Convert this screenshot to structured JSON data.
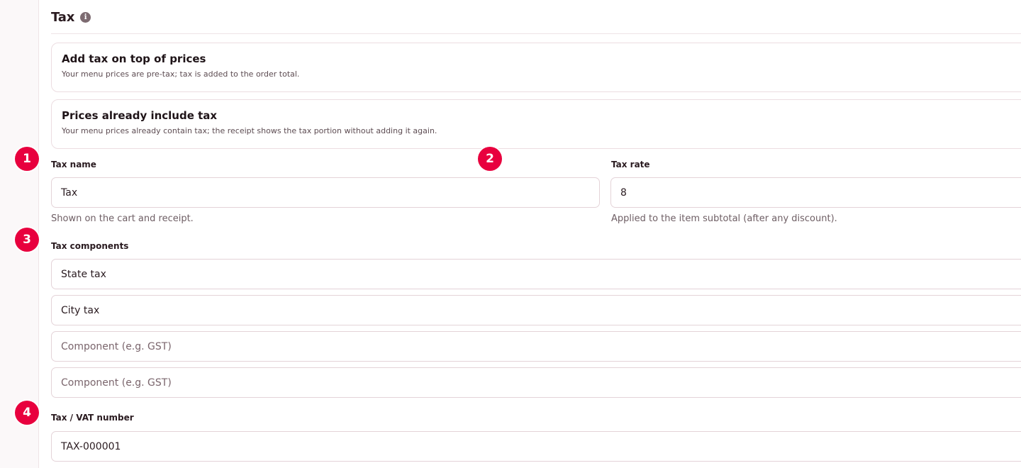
{
  "section": {
    "title": "Tax"
  },
  "options": [
    {
      "title": "Add tax on top of prices",
      "description": "Your menu prices are pre-tax; tax is added to the order total."
    },
    {
      "title": "Prices already include tax",
      "description": "Your menu prices already contain tax; the receipt shows the tax portion without adding it again."
    }
  ],
  "tax_name": {
    "label": "Tax name",
    "value": "Tax",
    "help": "Shown on the cart and receipt."
  },
  "tax_rate": {
    "label": "Tax rate",
    "value": "8",
    "help": "Applied to the item subtotal (after any discount)."
  },
  "components": {
    "label": "Tax components",
    "items": [
      {
        "value": "State tax",
        "placeholder": ""
      },
      {
        "value": "City tax",
        "placeholder": ""
      },
      {
        "value": "",
        "placeholder": "Component (e.g. GST)"
      },
      {
        "value": "",
        "placeholder": "Component (e.g. GST)"
      }
    ]
  },
  "vat": {
    "label": "Tax / VAT number",
    "value": "TAX-000001"
  },
  "badges": [
    "1",
    "2",
    "3",
    "4"
  ],
  "colors": {
    "badge": "#e8003e",
    "border": "#e4d3d8",
    "text": "#2a1b20"
  },
  "icons": {
    "info": "info-icon"
  }
}
